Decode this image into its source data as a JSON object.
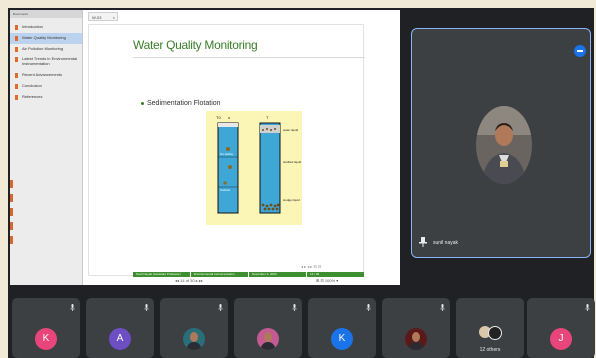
{
  "presentation": {
    "sidebar_header": "Bookmarks",
    "outline": [
      "Introduction",
      "Water Quality Monitoring",
      "Air Pollution Monitoring",
      "Latest Trends in Environmental Instrumentation",
      "Recent Advancements",
      "Conclusion",
      "References"
    ],
    "active_index": 1,
    "doc_tab": "W-03",
    "slide": {
      "title": "Water Quality Monitoring",
      "bullet": "Sedimentation Flotation",
      "diagram_labels": {
        "t0": "T0",
        "t": "T",
        "right_1": "water liquid",
        "right_2": "clarified liquid",
        "right_3": "sludge liquid",
        "left_1": "floc settling",
        "left_2": "hindered"
      },
      "footer": [
        "Sunil Nayak (Assistant Professor)",
        "Environmental Instrumentation",
        "November 2, 2023",
        "14 / 30"
      ],
      "nav": "◂ ▸ ◂ ▸ ⊟ ⊡"
    },
    "status_left": "◂◂ 14 of 30 ▸ ▸▸",
    "status_right": "⊞ ⊟ 100% ▾"
  },
  "main_tile": {
    "name": "sunil nayak",
    "colors": {
      "border": "#8ab4f8",
      "options": "#1a73e8"
    }
  },
  "participants": [
    {
      "initial": "K",
      "color": "#e8457b",
      "type": "letter"
    },
    {
      "initial": "A",
      "color": "#6e4ec3",
      "type": "letter"
    },
    {
      "initial": "",
      "color": "#2a6e7a",
      "type": "photo-man"
    },
    {
      "initial": "",
      "color": "#c45a92",
      "type": "photo-woman"
    },
    {
      "initial": "K",
      "color": "#1a73e8",
      "type": "letter"
    },
    {
      "initial": "",
      "color": "#5a1a1a",
      "type": "photo-dark"
    },
    {
      "initial": "",
      "color": "#3c4043",
      "type": "others",
      "label": "12 others"
    },
    {
      "initial": "J",
      "color": "#e8457b",
      "type": "letter"
    }
  ]
}
